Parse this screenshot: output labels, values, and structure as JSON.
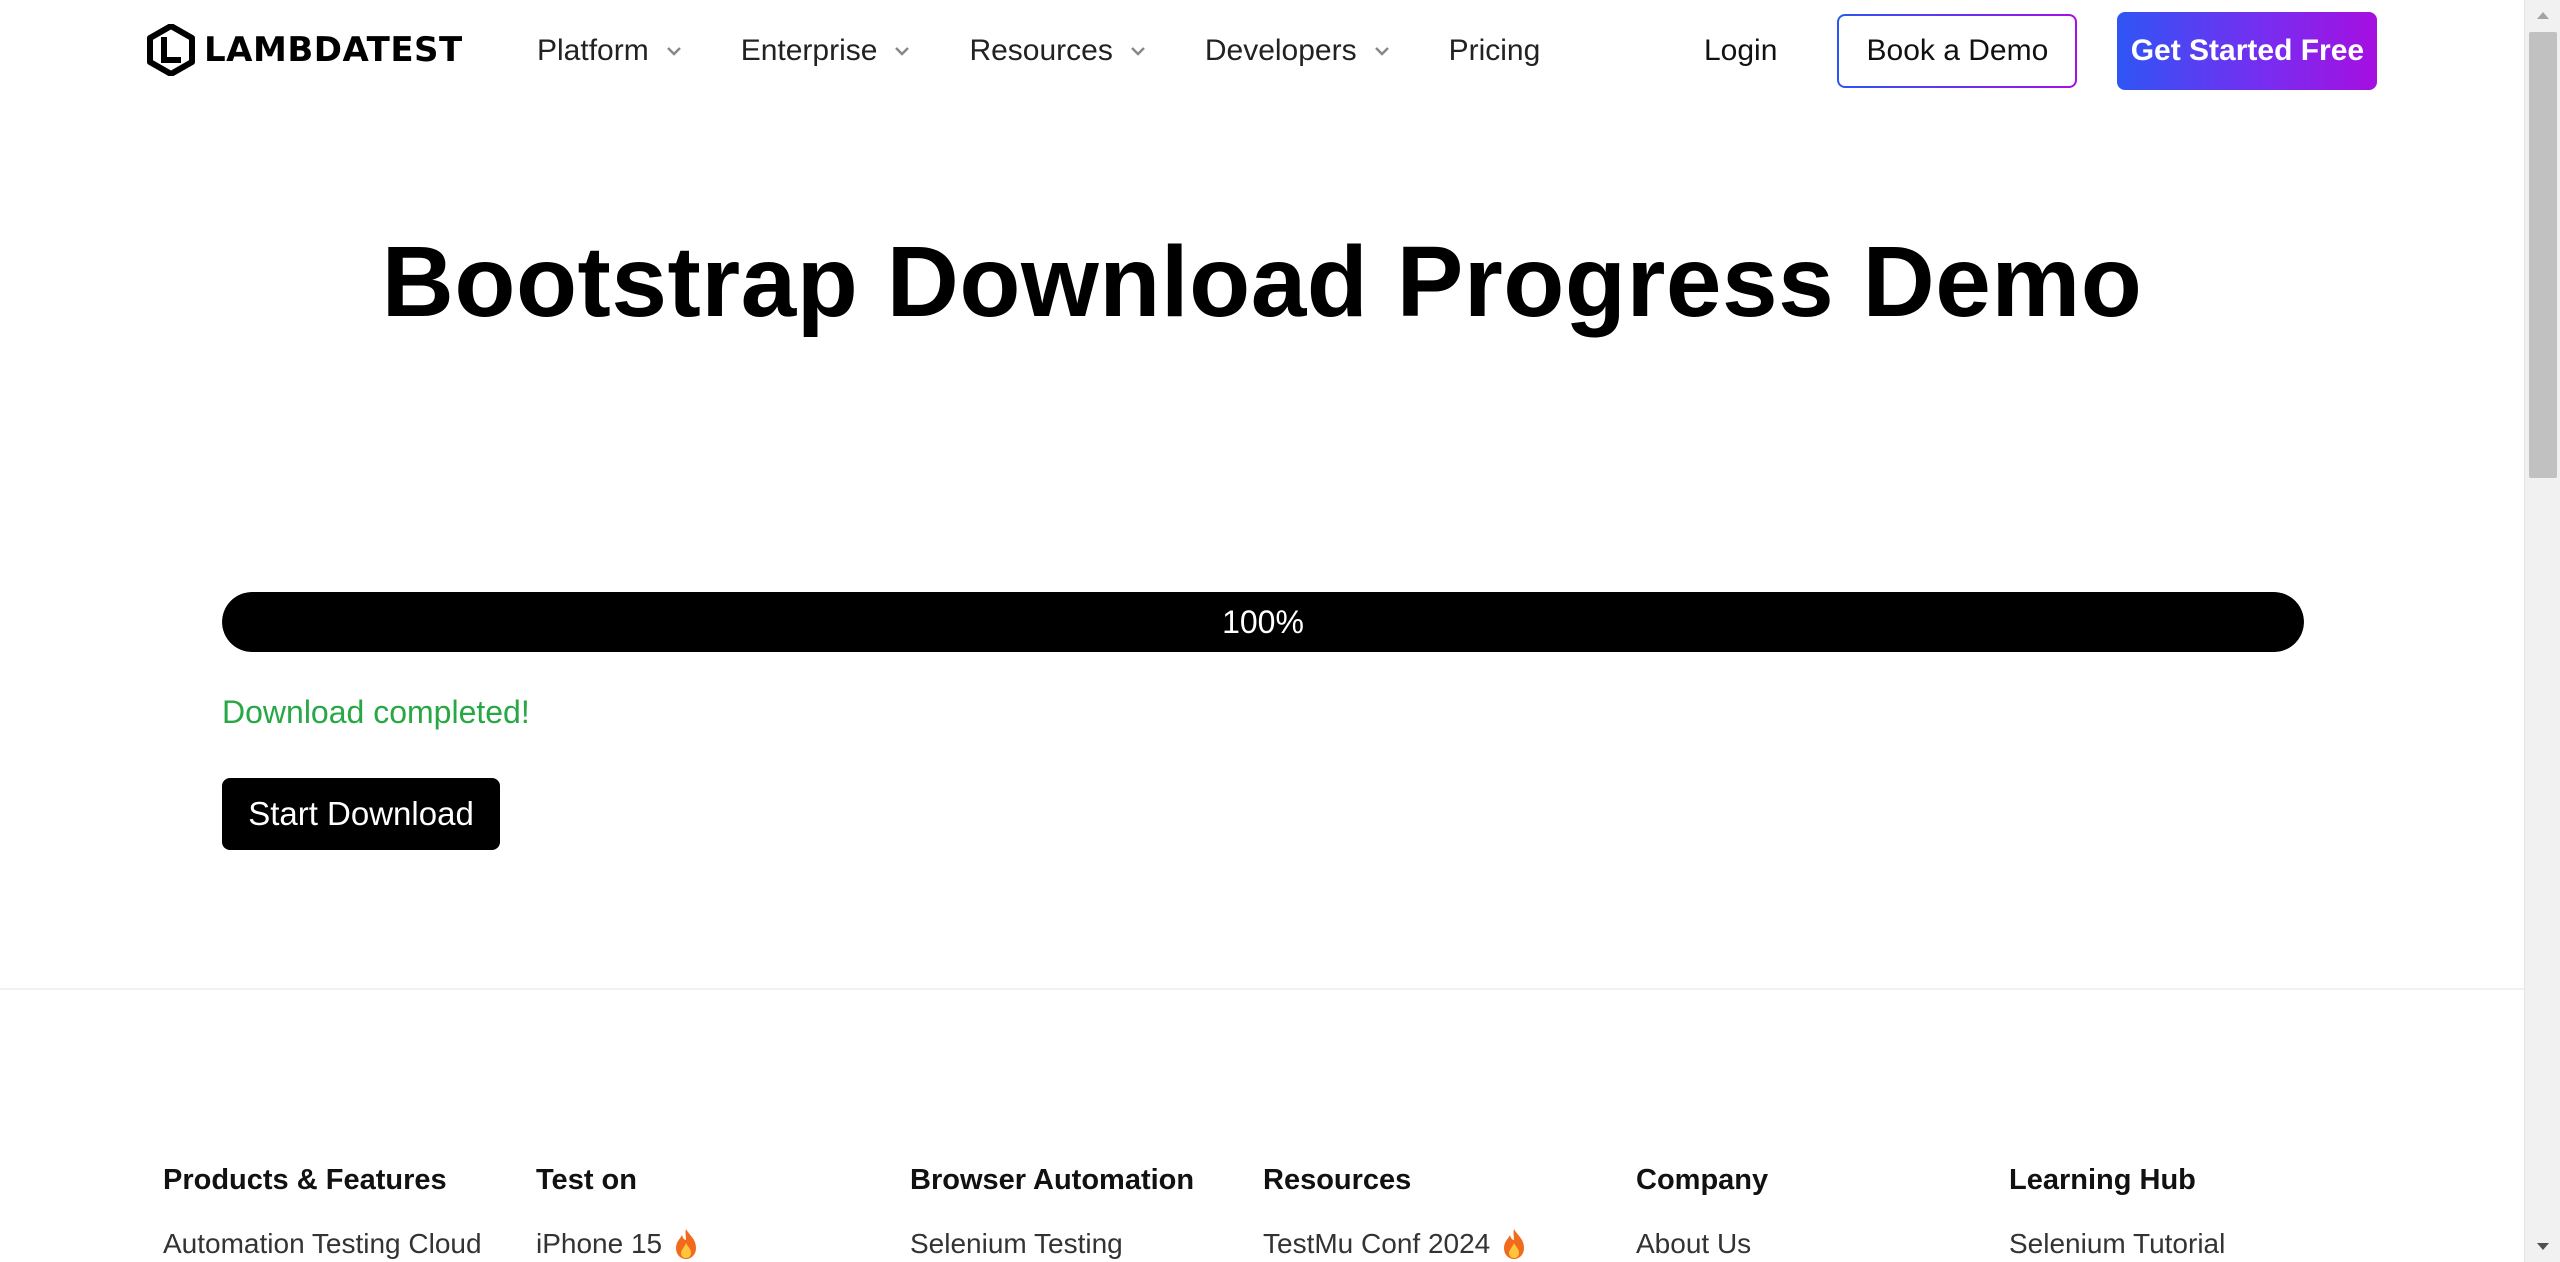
{
  "brand": {
    "logo_text": "LAMBDATEST"
  },
  "nav": {
    "items": [
      {
        "label": "Platform",
        "has_dropdown": true
      },
      {
        "label": "Enterprise",
        "has_dropdown": true
      },
      {
        "label": "Resources",
        "has_dropdown": true
      },
      {
        "label": "Developers",
        "has_dropdown": true
      },
      {
        "label": "Pricing",
        "has_dropdown": false
      }
    ],
    "login_label": "Login",
    "book_demo_label": "Book a Demo",
    "get_started_label": "Get Started Free"
  },
  "main": {
    "title": "Bootstrap Download Progress Demo",
    "progress": {
      "percent": 100,
      "label": "100%"
    },
    "status": "Download completed!",
    "start_button_label": "Start Download"
  },
  "footer": {
    "columns": [
      {
        "heading": "Products & Features",
        "links": [
          {
            "label": "Automation Testing Cloud",
            "hot": false
          }
        ]
      },
      {
        "heading": "Test on",
        "links": [
          {
            "label": "iPhone 15",
            "hot": true
          }
        ]
      },
      {
        "heading": "Browser Automation",
        "links": [
          {
            "label": "Selenium Testing",
            "hot": false
          }
        ]
      },
      {
        "heading": "Resources",
        "links": [
          {
            "label": "TestMu Conf 2024",
            "hot": true
          }
        ]
      },
      {
        "heading": "Company",
        "links": [
          {
            "label": "About Us",
            "hot": false
          }
        ]
      },
      {
        "heading": "Learning Hub",
        "links": [
          {
            "label": "Selenium Tutorial",
            "hot": false
          }
        ]
      }
    ]
  },
  "icons": {
    "logo": "lambdatest-logo-icon",
    "dropdown": "chevron-down-icon",
    "hot": "flame-icon",
    "scroll_up": "arrow-up-icon",
    "scroll_down": "arrow-down-icon"
  },
  "colors": {
    "accent_gradient_start": "#2f55f5",
    "accent_gradient_end": "#a50fe0",
    "progress_fill": "#000000",
    "success_text": "#28a745",
    "primary_button": "#000000"
  }
}
